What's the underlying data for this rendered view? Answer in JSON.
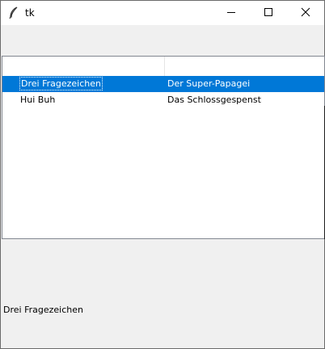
{
  "window": {
    "title": "tk",
    "icon": "feather-icon",
    "controls": {
      "minimize": "minimize-icon",
      "maximize": "maximize-icon",
      "close": "close-icon"
    }
  },
  "tree": {
    "columns": [
      "",
      ""
    ],
    "rows": [
      {
        "col1": "Drei Fragezeichen",
        "col2": "Der Super-Papagei",
        "selected": true
      },
      {
        "col1": "Hui Buh",
        "col2": "Das Schlossgespenst",
        "selected": false
      }
    ]
  },
  "label": {
    "text": "Drei Fragezeichen"
  },
  "colors": {
    "selection": "#0078d7",
    "window_bg": "#f0f0f0"
  }
}
